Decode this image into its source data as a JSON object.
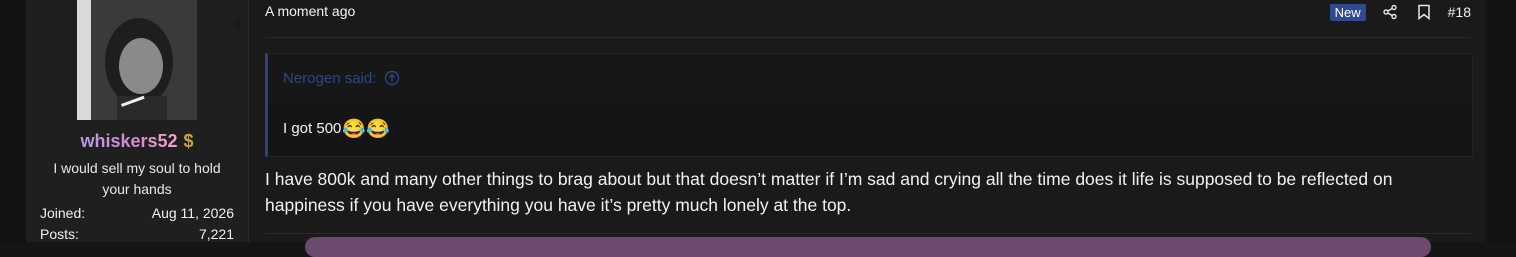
{
  "user": {
    "username": "whiskers52",
    "title": "I would sell my soul to hold your hands",
    "stats": [
      {
        "label": "Joined:",
        "value": "Aug 11, 2026"
      },
      {
        "label": "Posts:",
        "value": "7,221"
      }
    ],
    "badge_icon": "dollar-sign-icon"
  },
  "post": {
    "timestamp": "A moment ago",
    "new_badge": "New",
    "post_number": "#18",
    "quote": {
      "author": "Nerogen said:",
      "text": "I got 500",
      "emoji": "😂😂"
    },
    "message": "I have 800k and many other things to brag about but that doesn’t matter if I’m sad and crying all the time does it life is supposed to be reflected on happiness if you have everything you have it’s pretty much lonely at the top."
  },
  "colors": {
    "background": "#1a1a1a",
    "sidebar": "#1f1f1f",
    "new_badge": "#2f4a8f",
    "quote_accent": "#2d4281",
    "signature_bar": "#6b4a6e"
  }
}
